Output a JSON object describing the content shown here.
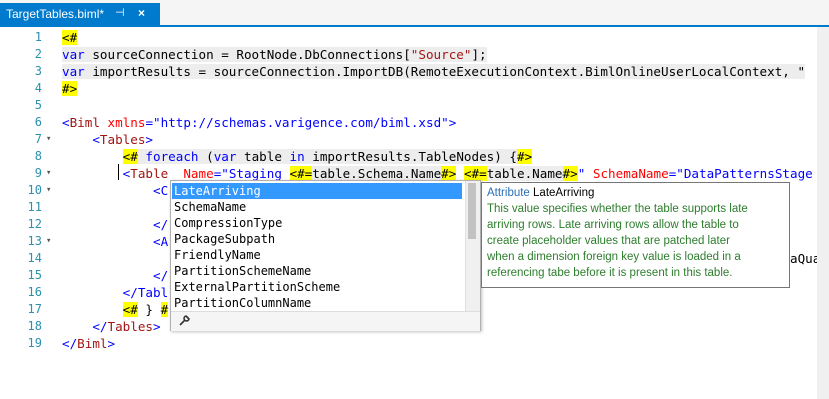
{
  "tab": {
    "title": "TargetTables.biml*",
    "pin": "⊣",
    "close": "×"
  },
  "line_numbers": [
    "1",
    "2",
    "3",
    "4",
    "5",
    "6",
    "7",
    "8",
    "9",
    "10",
    "11",
    "12",
    "13",
    "14",
    "15",
    "16",
    "17",
    "18",
    "19"
  ],
  "code": {
    "l1": "<#",
    "l2a": "var",
    "l2b": " sourceConnection = RootNode.DbConnections[",
    "l2c": "\"Source\"",
    "l2d": "];",
    "l3a": "var",
    "l3b": " importResults = sourceConnection.ImportDB(RemoteExecutionContext.BimlOnlineUserLocalContext, \"",
    "l4": "#>",
    "l6a": "<",
    "l6b": "Biml",
    "l6c": " xmlns",
    "l6d": "=\"",
    "l6e": "http://schemas.varigence.com/biml.xsd",
    "l6f": "\">",
    "l7a": "    <",
    "l7b": "Tables",
    "l7c": ">",
    "l8a": "        ",
    "l8b": "<#",
    "l8c": " foreach",
    "l8d": " (",
    "l8e": "var",
    "l8f": " table ",
    "l8g": "in",
    "l8h": " importResults.TableNodes) {",
    "l8i": "#>",
    "l9a": "        <",
    "l9b": "Table",
    "l9c": "  ",
    "l9d": "Name",
    "l9e": "=\"Staging_",
    "l9f": "<#=",
    "l9g": "table.Schema.Name",
    "l9h": "#>",
    "l9i": "_",
    "l9j": "<#=",
    "l9k": "table.Name",
    "l9l": "#>",
    "l9m": "\" ",
    "l9n": "SchemaName",
    "l9o": "=\"DataPatternsStage",
    "l10": "            <C",
    "l12": "            </",
    "l13": "            <A",
    "l14tail": "aQua",
    "l15": "            </",
    "l16": "        </Tabl",
    "l17a": "        ",
    "l17b": "<#",
    "l17c": " } ",
    "l17d": "#",
    "l18a": "    </",
    "l18b": "Tables",
    "l18c": ">",
    "l19a": "</",
    "l19b": "Biml",
    "l19c": ">"
  },
  "completion": {
    "items": [
      "LateArriving",
      "SchemaName",
      "CompressionType",
      "PackageSubpath",
      "FriendlyName",
      "PartitionSchemeName",
      "ExternalPartitionScheme",
      "PartitionColumnName"
    ],
    "selected": "LateArriving",
    "footer_icon": "wrench-icon"
  },
  "tooltip": {
    "kind": "Attribute",
    "name": "LateArriving",
    "lines": [
      "This value specifies whether the table supports late",
      "arriving rows. Late arriving rows allow the table to",
      "create placeholder values that are patched later",
      "when a dimension foreign key value is loaded in a",
      "referencing tabe before it is present in this table."
    ]
  },
  "colors": {
    "accent": "#007acc",
    "keyword": "#0000ff",
    "element": "#a31515",
    "attribute": "#ff0000",
    "highlight": "#ffff00",
    "line_number": "#2b91af"
  }
}
